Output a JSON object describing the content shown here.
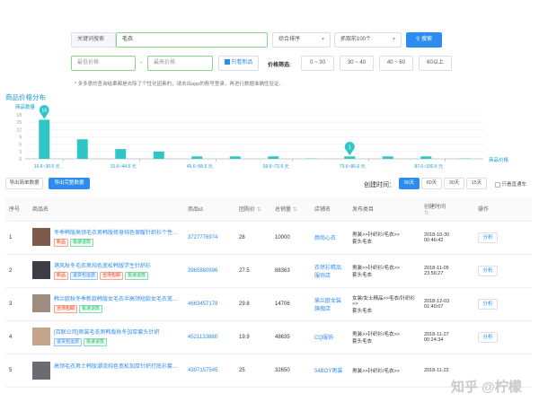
{
  "search": {
    "keyword_label": "关键词搜索",
    "keyword_value": "毛衣",
    "sort_selected": "综合排序",
    "page_selected": "抓取前100个",
    "search_button": "搜索",
    "min_price_placeholder": "最低价格",
    "dash": "-",
    "max_price_placeholder": "最高价格",
    "only_new_label": "只看新品",
    "price_filter_label": "价格筛选:",
    "price_ranges": [
      "0 ~ 30",
      "30 ~ 40",
      "40 ~ 60",
      "60以上"
    ],
    "note": "* 多多意的查询结果都是去除了个性化因素的，请去出app的账号登录，再进行数据准确性验证。"
  },
  "chart_data": {
    "type": "bar",
    "title": "商品价格分布",
    "ylabel": "商品数量",
    "xlabel": "商品价格",
    "categories": [
      "16.6~30.6 元",
      "31.6~44.6 元",
      "45.6~58.6 元",
      "59.6~72.6 元",
      "73.6~86.6 元",
      "87.6~100.6 元"
    ],
    "x": [
      16.6,
      24.1,
      31.6,
      38.1,
      45.6,
      52.1,
      59.6,
      66.1,
      73.6,
      80.1,
      87.6,
      94.1
    ],
    "values": [
      16,
      8,
      4,
      3,
      1,
      1,
      1,
      0,
      1,
      1,
      1,
      0
    ],
    "yticks": [
      0,
      3,
      6,
      9,
      12,
      15,
      18
    ],
    "ylim": [
      0,
      18
    ],
    "highlight": [
      {
        "label": "16",
        "index": 0
      },
      {
        "label": "1",
        "index": 8
      }
    ],
    "color": "#2ec6c6"
  },
  "toolbar": {
    "export_simple": "导出简单数据",
    "export_full": "导出完整数据",
    "created_label": "创建时间：",
    "ranges": [
      "90天",
      "60天",
      "30天",
      "15天"
    ],
    "active_range": "90天",
    "only_direct": "只看直通车"
  },
  "table": {
    "headers": [
      "序号",
      "商品名",
      "商品id",
      "团购价",
      "总销量",
      "店铺名",
      "发布类目",
      "创建时间",
      "操作"
    ],
    "rows": [
      {
        "no": "1",
        "name": "冬季韩版高领毛衣男韩版修身纯色保暖针织衫个性潮流百搭",
        "tags": [
          "新品",
          "极速退款"
        ],
        "id": "3727776974",
        "price": "28",
        "sales": "10000",
        "shop": "颜尚心衣",
        "cat1": "男装>>针织衫/毛衣>>",
        "cat2": "套头毛衣",
        "date": "2018-10-30",
        "time": "00:46:42",
        "op": "分析"
      },
      {
        "no": "2",
        "name": "港风秋冬毛衣男纯色宽松韩版学生针织衫",
        "tags": [
          "新品",
          "退货包运费",
          "全场包邮",
          "极速退款"
        ],
        "id": "3965880696",
        "price": "27.5",
        "sales": "88363",
        "shop": "衣然衫精品服饰店",
        "cat1": "男装>>针织衫/毛衣>>",
        "cat2": "套头毛衣",
        "date": "2018-11-05",
        "time": "23:56:27",
        "op": "分析"
      },
      {
        "no": "3",
        "name": "韩兰欧秋冬季新款韩版女毛衣半高领短款女毛衣宽松百搭加加绒",
        "tags": [
          "全场包邮",
          "极速退款"
        ],
        "id": "4663457178",
        "price": "29.8",
        "sales": "14706",
        "shop": "瑜兰欧女装旗舰店",
        "cat1": "女装/女士精品>>毛衣/针织衫>>",
        "cat2": "套头毛衣",
        "date": "2018-12-03",
        "time": "01:40:07",
        "op": "分析"
      },
      {
        "no": "4",
        "name": "[百联公司]男装毛衣男韩版秋冬加厚套头针织",
        "tags": [
          "退货包运费",
          "极速退款"
        ],
        "id": "4521133888",
        "price": "19.9",
        "sales": "48635",
        "shop": "CQ服饰",
        "cat1": "男装>>针织衫/毛衣>>",
        "cat2": "套头毛衣",
        "date": "2018-11-27",
        "time": "00:24:34",
        "op": "分析"
      },
      {
        "no": "5",
        "name": "高领毛衣男士韩版潮流纯色宽松加厚针织打底衫套男秋冬季",
        "tags": [],
        "id": "4397157545",
        "price": "25",
        "sales": "32650",
        "shop": "54BOY男装",
        "cat1": "男装>>针织衫/毛衣>>",
        "cat2": "",
        "date": "2018-11-22",
        "time": "",
        "op": ""
      }
    ]
  },
  "watermark": "知乎 @柠檬"
}
